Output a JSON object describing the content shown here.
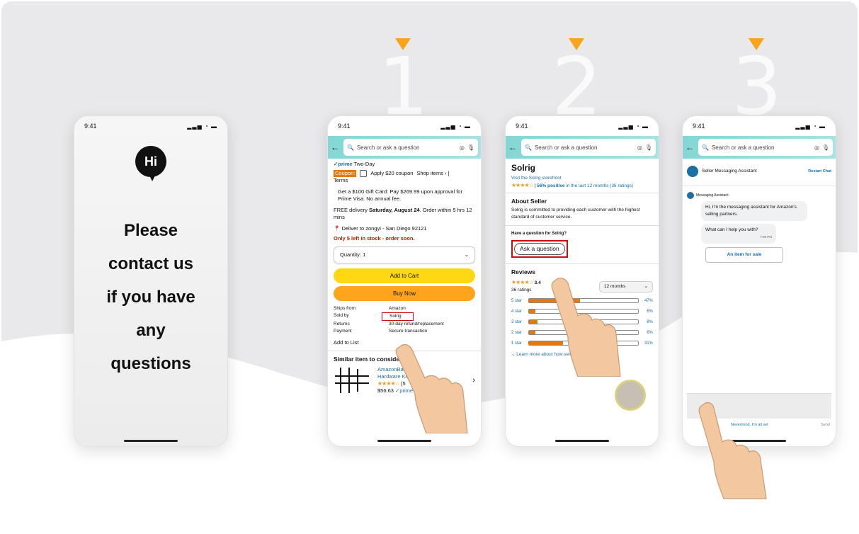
{
  "steps": [
    "1",
    "2",
    "3"
  ],
  "left_phone": {
    "time": "9:41",
    "logo": "Hi",
    "message_lines": [
      "Please",
      "contact us",
      "if you have",
      "any",
      "questions"
    ]
  },
  "status_icons": "▂▃▅ ◔ ▬",
  "search_placeholder": "Search or ask a question",
  "p1": {
    "time": "9:41",
    "prime": "✓prime",
    "prime_text": " Two-Day",
    "coupon": "Coupon:",
    "coupon_text": "Apply $20 coupon",
    "shop_items": "Shop items › |",
    "terms": "Terms",
    "gift": "Get a $100 Gift Card: Pay $269.99 upon approval for Prime Visa. No annual fee.",
    "delivery_pre": "FREE delivery ",
    "delivery_date": "Saturday, August 24",
    "delivery_post": ". Order within 5 hrs 12 mins",
    "deliver_to": "Deliver to zongyi - San Diego 92121",
    "stock": "Only 5 left in stock - order soon.",
    "quantity": "Quantity: 1",
    "add_to_cart": "Add to Cart",
    "buy_now": "Buy Now",
    "details": [
      [
        "Ships from",
        "Amazon"
      ],
      [
        "Sold by",
        "Solrig"
      ],
      [
        "Returns",
        "30-day refund/replacement"
      ],
      [
        "Payment",
        "Secure transaction"
      ]
    ],
    "add_to_list": "Add to List",
    "similar": "Similar item to consider",
    "sim_title": "AmazonBasics",
    "sim_sub": "Hardware Kit",
    "sim_rating": "(5",
    "sim_price": "$56.63",
    "sim_prime": "✓prime"
  },
  "p2": {
    "time": "9:41",
    "seller": "Solrig",
    "storefront": "Visit the Solrig storefront",
    "positive": "56% positive",
    "positive_rest": " in the last 12 months (36 ratings)",
    "about_title": "About Seller",
    "about_text": "Solrig is committed to providing each customer with the highest standard of customer service.",
    "question_label": "Have a question for Solrig?",
    "ask_button": "Ask a question",
    "reviews_title": "Reviews",
    "review_score": "3.4",
    "review_count": "36 ratings",
    "period": "12 months",
    "rows": [
      {
        "label": "5 star",
        "value": 47,
        "pct": "47%"
      },
      {
        "label": "4 star",
        "value": 6,
        "pct": "6%"
      },
      {
        "label": "3 star",
        "value": 8,
        "pct": "8%"
      },
      {
        "label": "2 star",
        "value": 6,
        "pct": "6%"
      },
      {
        "label": "1 star",
        "value": 31,
        "pct": "31%"
      }
    ],
    "learn_more": "Learn more about how seller reviews work"
  },
  "p3": {
    "time": "9:41",
    "assistant": "Seller Messaging Assistant",
    "restart": "Restart Chat",
    "msg_label": "Messaging Assistant",
    "msg1": "Hi, I'm the messaging assistant for Amazon's selling partners.",
    "msg2": "What can I help you with?",
    "msg2_time": "7:05 PM",
    "option": "An item for sale",
    "nevermind": "Nevermind, I'm all set",
    "send": "Send"
  },
  "colors": {
    "accent": "#f7a51c",
    "cart": "#ffd814",
    "buy": "#ffa41c",
    "bars": "#e47911",
    "highlight_border": "#cc0c0c"
  }
}
